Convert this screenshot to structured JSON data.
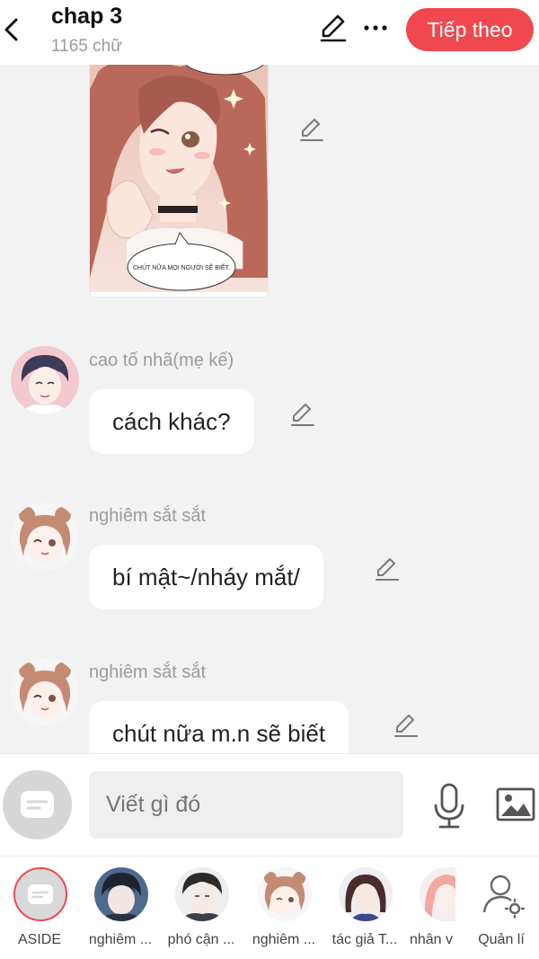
{
  "header": {
    "title": "chap 3",
    "word_count": "1165 chữ",
    "next_label": "Tiếp theo"
  },
  "image_message": {
    "caption": "CHÚT NỮA MỌI NGƯỜI SẼ BIẾT."
  },
  "messages": [
    {
      "sender": "cao tố nhã(mẹ kế)",
      "text": "cách khác?"
    },
    {
      "sender": "nghiêm sắt sắt",
      "text": "bí mật~/nháy mắt/"
    },
    {
      "sender": "nghiêm sắt sắt",
      "text": "chút nữa m.n sẽ biết"
    }
  ],
  "composer": {
    "placeholder": "Viết gì đó"
  },
  "roles": [
    {
      "name": "ASIDE"
    },
    {
      "name": "nghiêm ..."
    },
    {
      "name": "phó cận ..."
    },
    {
      "name": "nghiêm ..."
    },
    {
      "name": "tác giả T..."
    },
    {
      "name": "nhân v"
    },
    {
      "name": "Quản lí"
    }
  ],
  "colors": {
    "accent": "#f1484f",
    "background": "#f2f2f2",
    "muted_text": "#9b9b9b"
  },
  "icons": {
    "back": "chevron-left-icon",
    "edit": "pencil-icon",
    "more": "more-dots-icon",
    "mic": "microphone-icon",
    "image": "image-icon",
    "manage": "user-gear-icon"
  }
}
